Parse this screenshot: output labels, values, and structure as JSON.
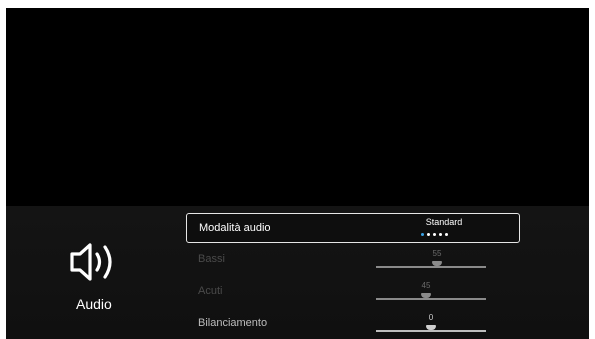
{
  "category": {
    "title": "Audio",
    "icon": "speaker-icon"
  },
  "menu": {
    "sound_mode": {
      "label": "Modalità audio",
      "value": "Standard",
      "option_count": 5,
      "selected_index": 0
    },
    "bass": {
      "label": "Bassi",
      "value": "55",
      "level": 0.55
    },
    "treble": {
      "label": "Acuti",
      "value": "45",
      "level": 0.45
    },
    "balance": {
      "label": "Bilanciamento",
      "value": "0",
      "level": 0.5
    }
  },
  "colors": {
    "accent": "#3aa3e6",
    "background": "#000000",
    "panel": "#141414"
  }
}
